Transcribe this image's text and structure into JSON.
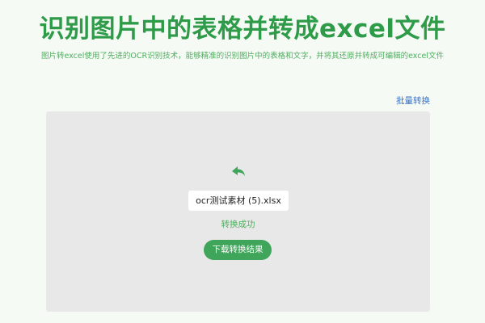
{
  "header": {
    "title": "识别图片中的表格并转成excel文件",
    "subtitle": "图片转excel使用了先进的OCR识别技术，能够精准的识别图片中的表格和文字，并将其还原并转成可编辑的excel文件"
  },
  "toolbar": {
    "batch_label": "批量转换"
  },
  "panel": {
    "undo_icon": "undo-arrow-icon",
    "file_name": "ocr测试素材 (5).xlsx",
    "status": "转换成功",
    "download_label": "下载转换结果"
  },
  "colors": {
    "accent": "#2e9b48",
    "button": "#3ea55a",
    "link": "#3a73c8",
    "panel_bg": "#e8e8e8",
    "page_bg": "#f5faf5"
  }
}
